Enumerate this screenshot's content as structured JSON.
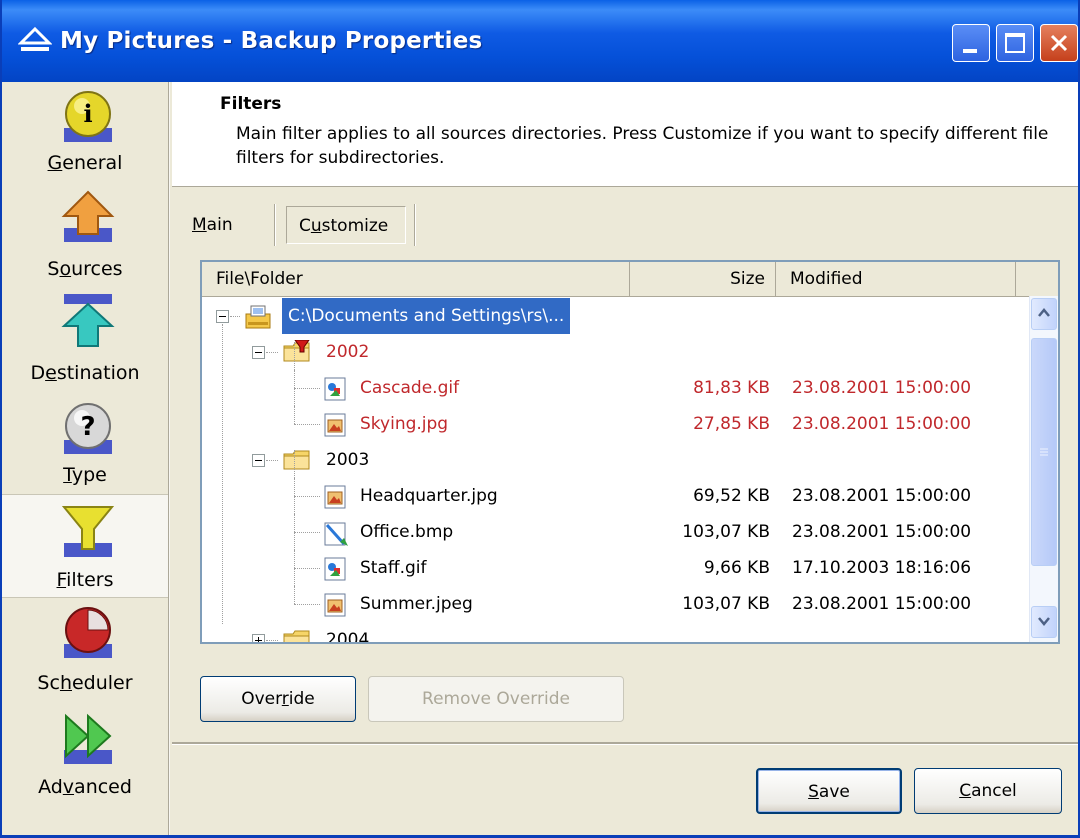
{
  "window": {
    "title": "My Pictures - Backup Properties"
  },
  "sidebar": {
    "items": [
      {
        "label": "General",
        "accel_index": 0,
        "icon": "info-icon"
      },
      {
        "label": "Sources",
        "accel_index": 1,
        "icon": "arrow-up-icon"
      },
      {
        "label": "Destination",
        "accel_index": 1,
        "icon": "arrow-down-icon"
      },
      {
        "label": "Type",
        "accel_index": 0,
        "icon": "question-icon"
      },
      {
        "label": "Filters",
        "accel_index": 0,
        "icon": "funnel-icon"
      },
      {
        "label": "Scheduler",
        "accel_index": 2,
        "icon": "pie-clock-icon"
      },
      {
        "label": "Advanced",
        "accel_index": 2,
        "icon": "double-arrow-icon"
      }
    ],
    "active": "Filters"
  },
  "header": {
    "title": "Filters",
    "description": "Main filter applies to all sources directories. Press Customize if you want to specify different file filters for subdirectories."
  },
  "tabs": {
    "main": "Main",
    "customize": "Customize"
  },
  "tree": {
    "columns": {
      "file": "File\\Folder",
      "size": "Size",
      "modified": "Modified"
    },
    "root": "C:\\Documents and Settings\\rs\\...",
    "rows": [
      {
        "level": 1,
        "name": "2002",
        "type": "folder-filtered",
        "red": true,
        "expanded": true
      },
      {
        "level": 2,
        "name": "Cascade.gif",
        "size": "81,83 KB",
        "modified": "23.08.2001 15:00:00",
        "red": true,
        "type": "gif"
      },
      {
        "level": 2,
        "name": "Skying.jpg",
        "size": "27,85 KB",
        "modified": "23.08.2001 15:00:00",
        "red": true,
        "type": "jpg"
      },
      {
        "level": 1,
        "name": "2003",
        "type": "folder",
        "red": false,
        "expanded": true
      },
      {
        "level": 2,
        "name": "Headquarter.jpg",
        "size": "69,52 KB",
        "modified": "23.08.2001 15:00:00",
        "red": false,
        "type": "jpg"
      },
      {
        "level": 2,
        "name": "Office.bmp",
        "size": "103,07 KB",
        "modified": "23.08.2001 15:00:00",
        "red": false,
        "type": "bmp"
      },
      {
        "level": 2,
        "name": "Staff.gif",
        "size": "9,66 KB",
        "modified": "17.10.2003 18:16:06",
        "red": false,
        "type": "gif"
      },
      {
        "level": 2,
        "name": "Summer.jpeg",
        "size": "103,07 KB",
        "modified": "23.08.2001 15:00:00",
        "red": false,
        "type": "jpg"
      },
      {
        "level": 1,
        "name": "2004",
        "type": "folder",
        "red": false,
        "expanded": false
      }
    ]
  },
  "buttons": {
    "override": "Override",
    "remove_override": "Remove Override",
    "save": "Save",
    "cancel": "Cancel"
  },
  "colors": {
    "titlebar": "#0550D8",
    "selection": "#316AC5",
    "filtered_text": "#C0282C"
  }
}
